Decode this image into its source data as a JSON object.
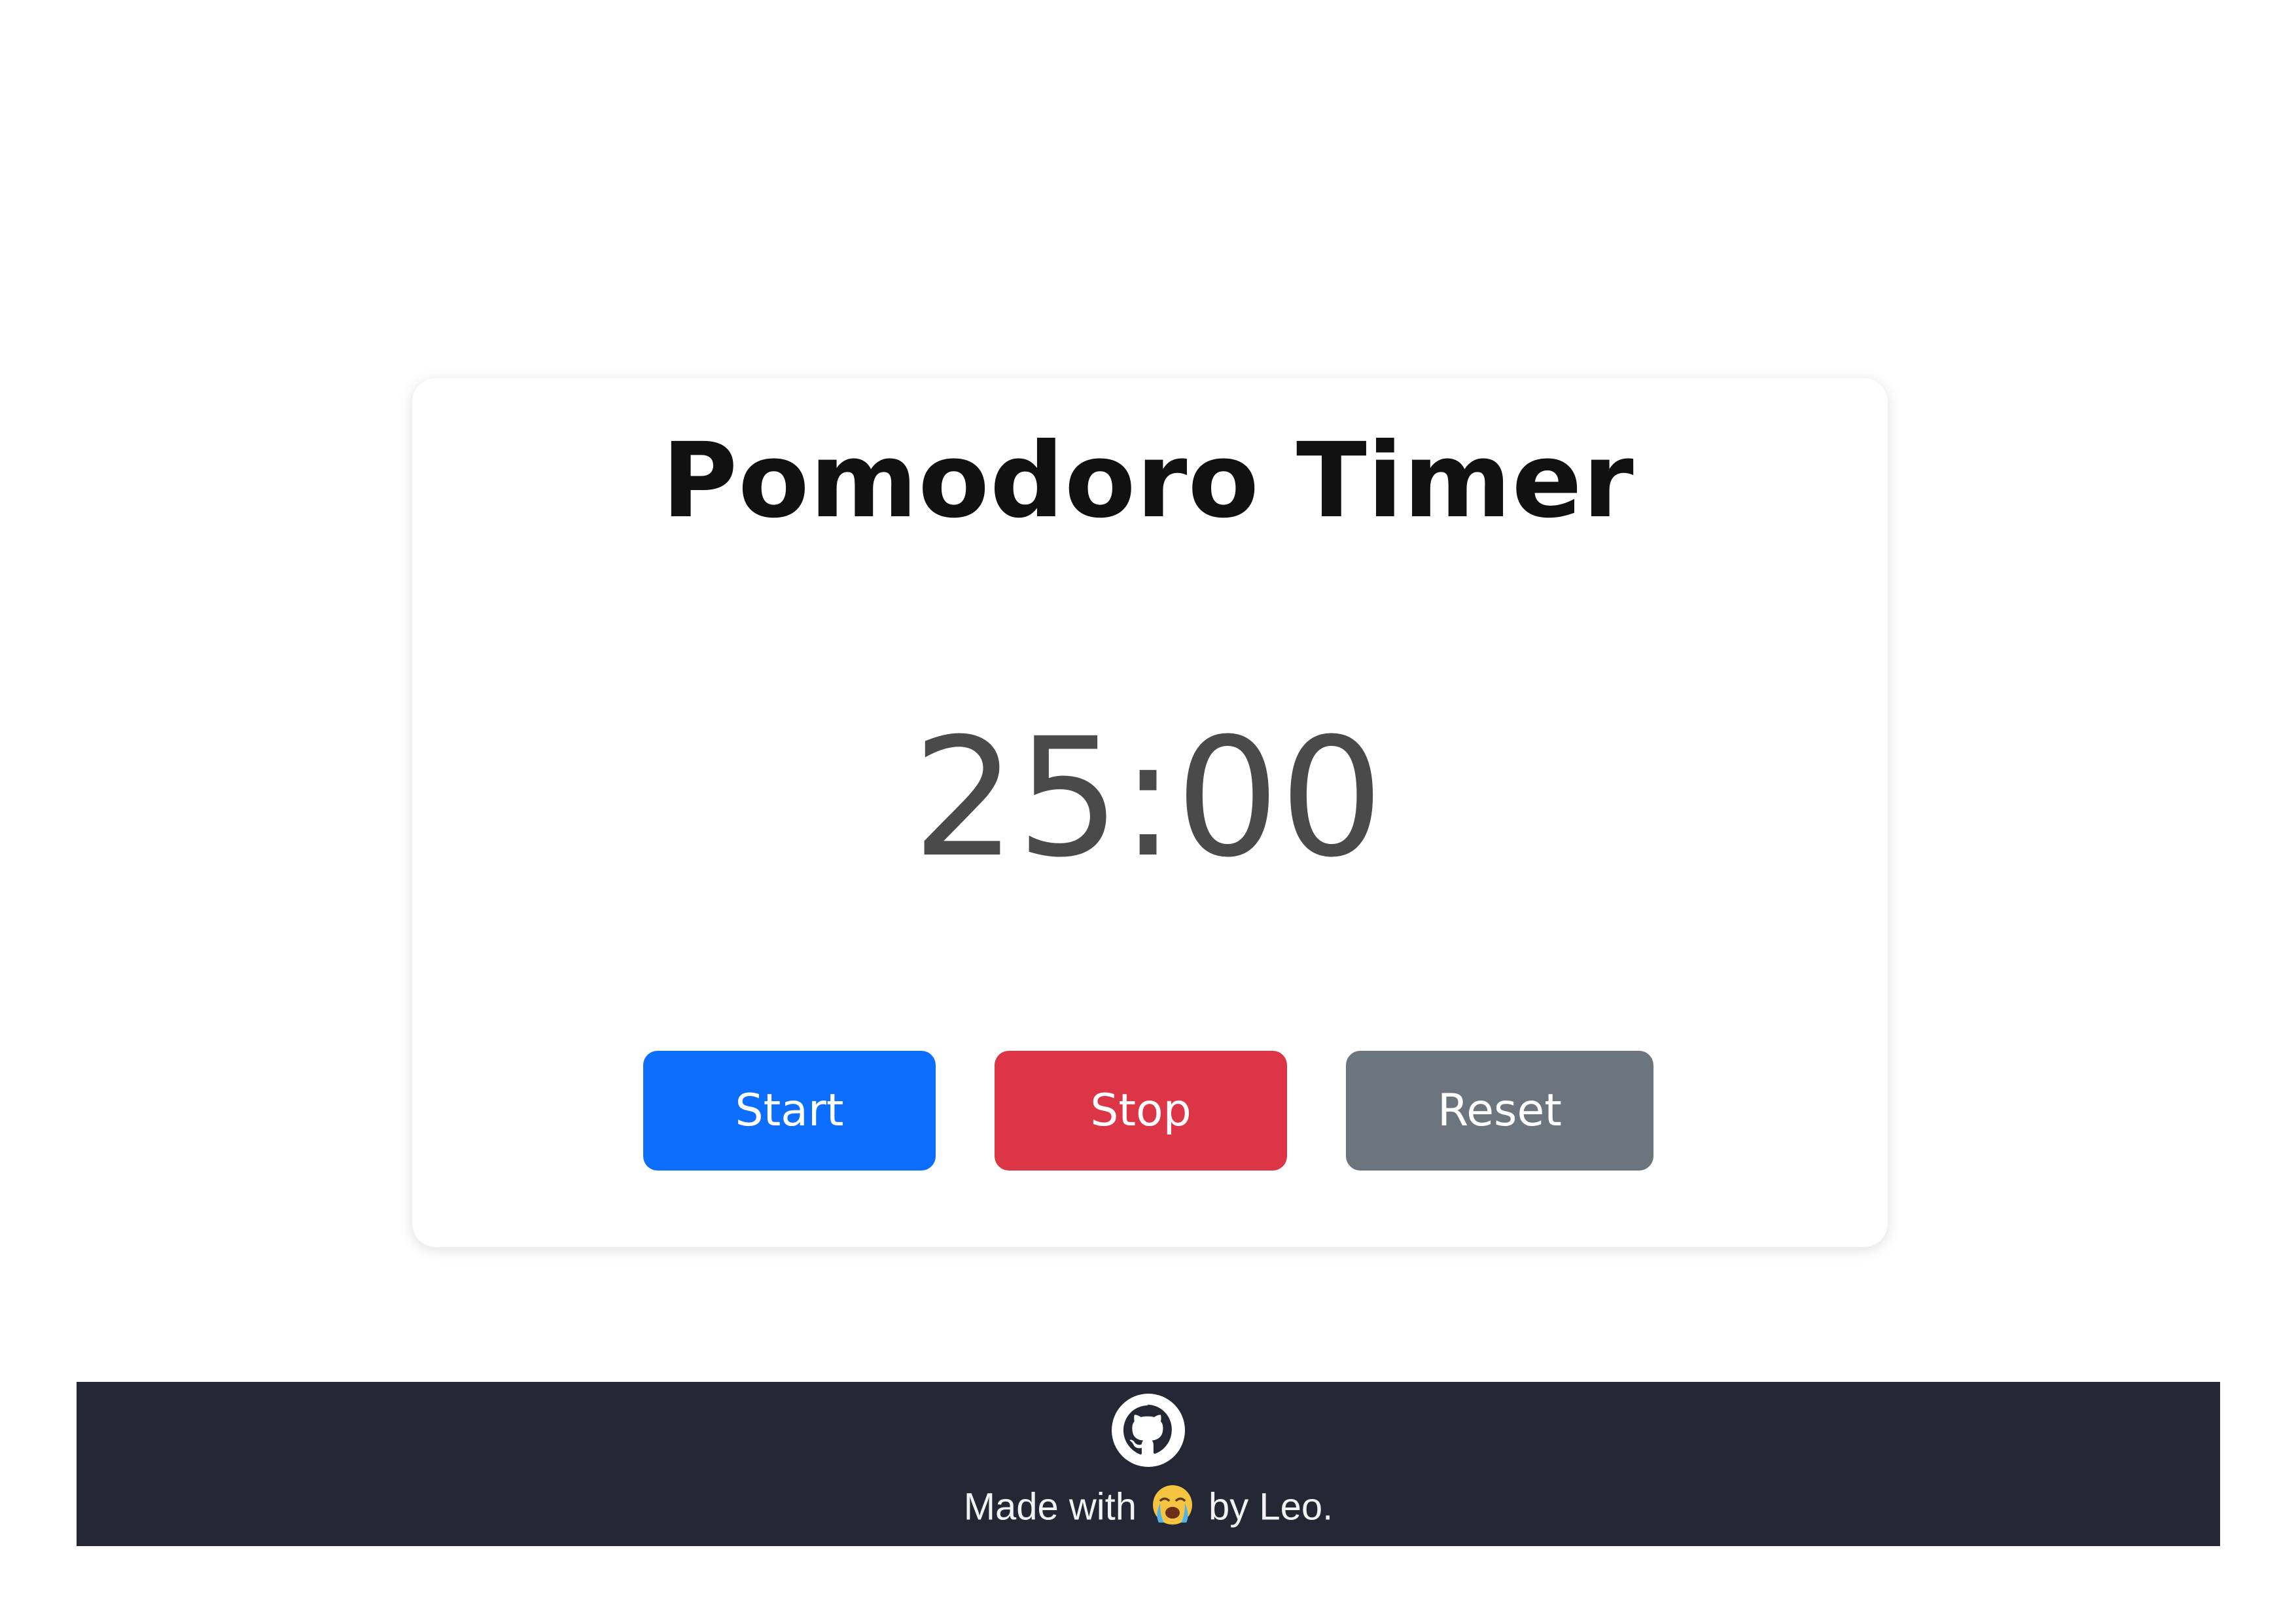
{
  "card": {
    "title": "Pomodoro Timer",
    "timer_display": "25:00"
  },
  "buttons": {
    "start_label": "Start",
    "stop_label": "Stop",
    "reset_label": "Reset"
  },
  "footer": {
    "made_with": "Made with",
    "by_text": "by Leo.",
    "emoji_icon": "loudly-crying-face-icon",
    "github_icon": "github-icon"
  },
  "colors": {
    "start": "#0d6efd",
    "stop": "#dc3545",
    "reset": "#6c757d",
    "footer_bg": "#252734",
    "timer_text": "#4a4a4a"
  }
}
